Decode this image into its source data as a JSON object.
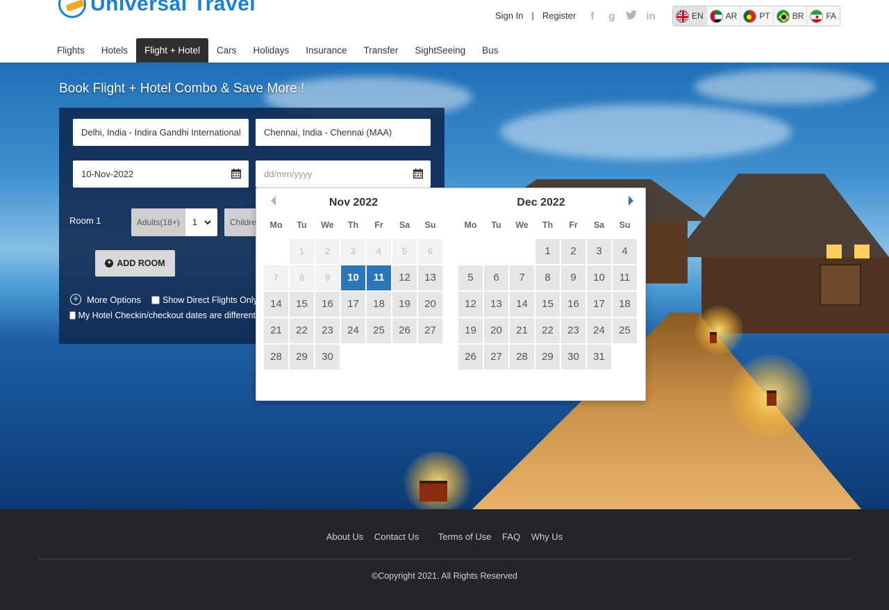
{
  "brand": {
    "name": "Universal Travel"
  },
  "auth": {
    "sign_in": "Sign In",
    "separator": "|",
    "register": "Register"
  },
  "social": [
    {
      "icon": "facebook-icon",
      "glyph": "f"
    },
    {
      "icon": "google-icon",
      "glyph": "g"
    },
    {
      "icon": "twitter-icon",
      "glyph": "t"
    },
    {
      "icon": "linkedin-icon",
      "glyph": "in"
    }
  ],
  "languages": [
    {
      "code": "EN",
      "flag": "uk-flag-icon",
      "active": true
    },
    {
      "code": "AR",
      "flag": "uae-flag-icon",
      "active": false
    },
    {
      "code": "PT",
      "flag": "portugal-flag-icon",
      "active": false
    },
    {
      "code": "BR",
      "flag": "brazil-flag-icon",
      "active": false
    },
    {
      "code": "FA",
      "flag": "iran-flag-icon",
      "active": false
    }
  ],
  "nav": {
    "items": [
      "Flights",
      "Hotels",
      "Flight + Hotel",
      "Cars",
      "Holidays",
      "Insurance",
      "Transfer",
      "SightSeeing",
      "Bus"
    ],
    "active": "Flight + Hotel"
  },
  "search": {
    "title": "Book Flight + Hotel Combo & Save More !",
    "from_value": "Delhi, India - Indira Gandhi International",
    "to_value": "Chennai, India - Chennai (MAA)",
    "depart_value": "10-Nov-2022",
    "return_placeholder": "dd/mm/yyyy",
    "room_label": "Room 1",
    "adults_label": "Adults(18+)",
    "adults_value": "1",
    "children_label": "Children",
    "add_room_label": "ADD ROOM",
    "more_options_label": "More Options",
    "direct_flights_label": "Show Direct Flights Only",
    "hotel_dates_label": "My Hotel Checkin/checkout dates are different"
  },
  "datepicker": {
    "weekdays": [
      "Mo",
      "Tu",
      "We",
      "Th",
      "Fr",
      "Sa",
      "Su"
    ],
    "months": [
      {
        "title": "Nov 2022",
        "lead_blanks": 0,
        "prev_days": [
          "",
          "1",
          "2",
          "3",
          "4",
          "5",
          "6",
          "7",
          "8",
          "9"
        ],
        "days": [
          {
            "d": "",
            "s": "blank"
          },
          {
            "d": "1",
            "s": "disabled"
          },
          {
            "d": "2",
            "s": "disabled"
          },
          {
            "d": "3",
            "s": "disabled"
          },
          {
            "d": "4",
            "s": "disabled"
          },
          {
            "d": "5",
            "s": "disabled"
          },
          {
            "d": "6",
            "s": "disabled"
          },
          {
            "d": "7",
            "s": "disabled"
          },
          {
            "d": "8",
            "s": "disabled"
          },
          {
            "d": "9",
            "s": "disabled"
          },
          {
            "d": "10",
            "s": "selected"
          },
          {
            "d": "11",
            "s": "selected"
          },
          {
            "d": "12",
            "s": "normal"
          },
          {
            "d": "13",
            "s": "normal"
          },
          {
            "d": "14",
            "s": "normal"
          },
          {
            "d": "15",
            "s": "normal"
          },
          {
            "d": "16",
            "s": "normal"
          },
          {
            "d": "17",
            "s": "normal"
          },
          {
            "d": "18",
            "s": "normal"
          },
          {
            "d": "19",
            "s": "normal"
          },
          {
            "d": "20",
            "s": "normal"
          },
          {
            "d": "21",
            "s": "normal"
          },
          {
            "d": "22",
            "s": "normal"
          },
          {
            "d": "23",
            "s": "normal"
          },
          {
            "d": "24",
            "s": "normal"
          },
          {
            "d": "25",
            "s": "normal"
          },
          {
            "d": "26",
            "s": "normal"
          },
          {
            "d": "27",
            "s": "normal"
          },
          {
            "d": "28",
            "s": "normal"
          },
          {
            "d": "29",
            "s": "normal"
          },
          {
            "d": "30",
            "s": "normal"
          }
        ]
      },
      {
        "title": "Dec 2022",
        "days": [
          {
            "d": "",
            "s": "blank"
          },
          {
            "d": "",
            "s": "blank"
          },
          {
            "d": "",
            "s": "blank"
          },
          {
            "d": "1",
            "s": "normal"
          },
          {
            "d": "2",
            "s": "normal"
          },
          {
            "d": "3",
            "s": "normal"
          },
          {
            "d": "4",
            "s": "normal"
          },
          {
            "d": "5",
            "s": "normal"
          },
          {
            "d": "6",
            "s": "normal"
          },
          {
            "d": "7",
            "s": "normal"
          },
          {
            "d": "8",
            "s": "normal"
          },
          {
            "d": "9",
            "s": "normal"
          },
          {
            "d": "10",
            "s": "normal"
          },
          {
            "d": "11",
            "s": "normal"
          },
          {
            "d": "12",
            "s": "normal"
          },
          {
            "d": "13",
            "s": "normal"
          },
          {
            "d": "14",
            "s": "normal"
          },
          {
            "d": "15",
            "s": "normal"
          },
          {
            "d": "16",
            "s": "normal"
          },
          {
            "d": "17",
            "s": "normal"
          },
          {
            "d": "18",
            "s": "normal"
          },
          {
            "d": "19",
            "s": "normal"
          },
          {
            "d": "20",
            "s": "normal"
          },
          {
            "d": "21",
            "s": "normal"
          },
          {
            "d": "22",
            "s": "normal"
          },
          {
            "d": "23",
            "s": "normal"
          },
          {
            "d": "24",
            "s": "normal"
          },
          {
            "d": "25",
            "s": "normal"
          },
          {
            "d": "26",
            "s": "normal"
          },
          {
            "d": "27",
            "s": "normal"
          },
          {
            "d": "28",
            "s": "normal"
          },
          {
            "d": "29",
            "s": "normal"
          },
          {
            "d": "30",
            "s": "normal"
          },
          {
            "d": "31",
            "s": "normal"
          }
        ]
      }
    ]
  },
  "footer": {
    "links": [
      "About Us",
      "Contact Us",
      "Terms of Use",
      "FAQ",
      "Why Us"
    ],
    "copyright": "©Copyright 2021. All Rights Reserved"
  },
  "colors": {
    "brand": "#1a7fd4",
    "selected_day": "#2a76b8",
    "nav_active": "#2f2f2f",
    "footer_bg": "#232528"
  }
}
